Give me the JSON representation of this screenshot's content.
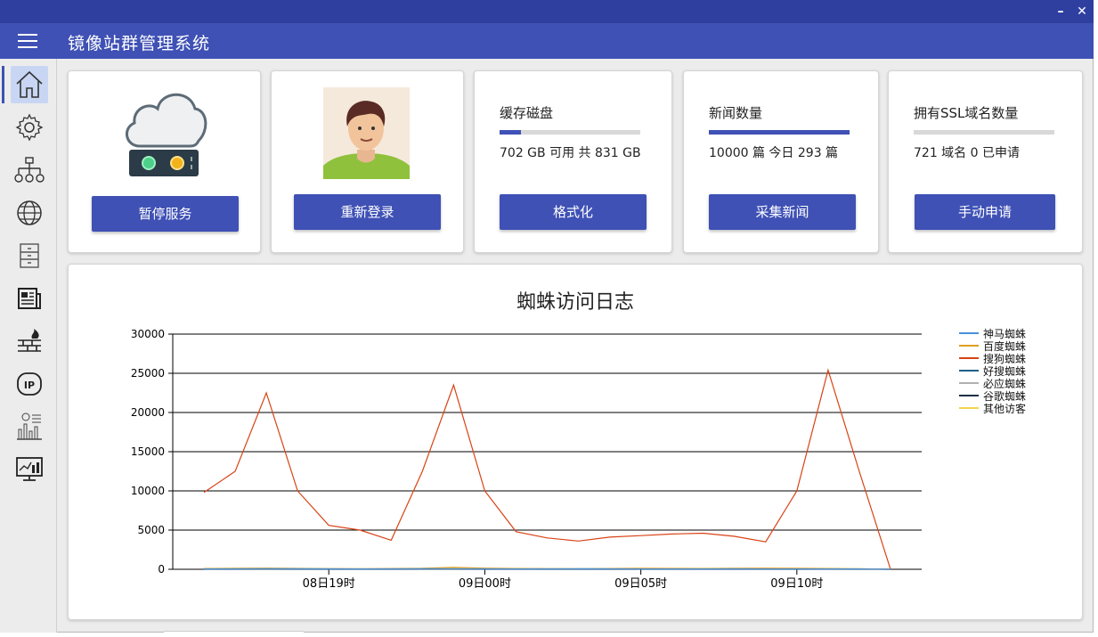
{
  "app": {
    "title": "镜像站群管理系统",
    "minimize": "–",
    "close": "✕"
  },
  "sidebar": {
    "items": [
      {
        "icon": "home-icon",
        "active": true
      },
      {
        "icon": "gear-icon"
      },
      {
        "icon": "sitemap-icon"
      },
      {
        "icon": "globe-icon"
      },
      {
        "icon": "cabinet-icon"
      },
      {
        "icon": "news-icon"
      },
      {
        "icon": "firewall-icon"
      },
      {
        "icon": "ip-icon"
      },
      {
        "icon": "stats-icon"
      },
      {
        "icon": "monitor-chart-icon"
      }
    ]
  },
  "cards": {
    "service": {
      "button": "暂停服务",
      "icon": "cloud-server-icon"
    },
    "login": {
      "button": "重新登录",
      "icon": "avatar"
    },
    "disk": {
      "label": "缓存磁盘",
      "value": "702 GB 可用 共 831 GB",
      "progress": 0.155,
      "button": "格式化"
    },
    "news": {
      "label": "新闻数量",
      "value": "10000 篇 今日 293 篇",
      "progress": 1.0,
      "button": "采集新闻"
    },
    "ssl": {
      "label": "拥有SSL域名数量",
      "value": "721 域名 0 已申请",
      "progress": 0.0,
      "button": "手动申请"
    }
  },
  "chart_data": {
    "type": "line",
    "title": "蜘蛛访问日志",
    "xlabel": "",
    "ylabel": "",
    "ylim": [
      0,
      30000
    ],
    "yticks": [
      0,
      5000,
      10000,
      15000,
      20000,
      25000,
      30000
    ],
    "x": [
      15,
      16,
      17,
      18,
      19,
      20,
      21,
      22,
      23,
      24,
      25,
      26,
      27,
      28,
      29,
      30,
      31,
      32,
      33,
      34,
      35,
      36,
      37
    ],
    "xlim": [
      14,
      38
    ],
    "xticks": [
      19,
      24,
      29,
      34
    ],
    "xtick_labels": [
      "08日19时",
      "09日00时",
      "09日05时",
      "09日10时"
    ],
    "grid": "horizontal",
    "legend_position": "right",
    "series": [
      {
        "name": "神马蜘蛛",
        "color": "#4a90d9",
        "values": [
          50,
          60,
          80,
          70,
          60,
          50,
          60,
          80,
          70,
          60,
          50,
          60,
          70,
          60,
          50,
          40,
          50,
          60,
          50,
          40,
          50,
          40,
          0
        ]
      },
      {
        "name": "百度蜘蛛",
        "color": "#e0a020",
        "values": [
          100,
          120,
          150,
          110,
          90,
          80,
          100,
          120,
          250,
          150,
          100,
          90,
          80,
          100,
          120,
          110,
          100,
          120,
          150,
          130,
          100,
          80,
          0
        ]
      },
      {
        "name": "搜狗蜘蛛",
        "color": "#d84315",
        "values": [
          9800,
          12500,
          22500,
          10000,
          5600,
          5000,
          3700,
          12500,
          23500,
          10000,
          4800,
          4000,
          3600,
          4100,
          4300,
          4500,
          4600,
          4200,
          3500,
          10000,
          25400,
          12500,
          0
        ]
      },
      {
        "name": "好搜蜘蛛",
        "color": "#1f5f8b",
        "values": [
          20,
          20,
          30,
          20,
          20,
          20,
          20,
          30,
          30,
          20,
          20,
          20,
          20,
          20,
          20,
          20,
          20,
          20,
          20,
          20,
          30,
          20,
          0
        ]
      },
      {
        "name": "必应蜘蛛",
        "color": "#b0b0b0",
        "values": [
          10,
          10,
          10,
          10,
          10,
          10,
          10,
          10,
          10,
          10,
          10,
          10,
          10,
          10,
          10,
          10,
          10,
          10,
          10,
          10,
          10,
          10,
          0
        ]
      },
      {
        "name": "谷歌蜘蛛",
        "color": "#1a2f45",
        "values": [
          5,
          5,
          5,
          5,
          5,
          5,
          5,
          5,
          5,
          5,
          5,
          5,
          5,
          5,
          5,
          5,
          5,
          5,
          5,
          5,
          5,
          5,
          0
        ]
      },
      {
        "name": "其他访客",
        "color": "#f3d54e",
        "values": [
          30,
          40,
          50,
          40,
          30,
          30,
          40,
          60,
          150,
          60,
          40,
          30,
          30,
          40,
          50,
          50,
          60,
          80,
          100,
          70,
          50,
          40,
          0
        ]
      }
    ]
  }
}
